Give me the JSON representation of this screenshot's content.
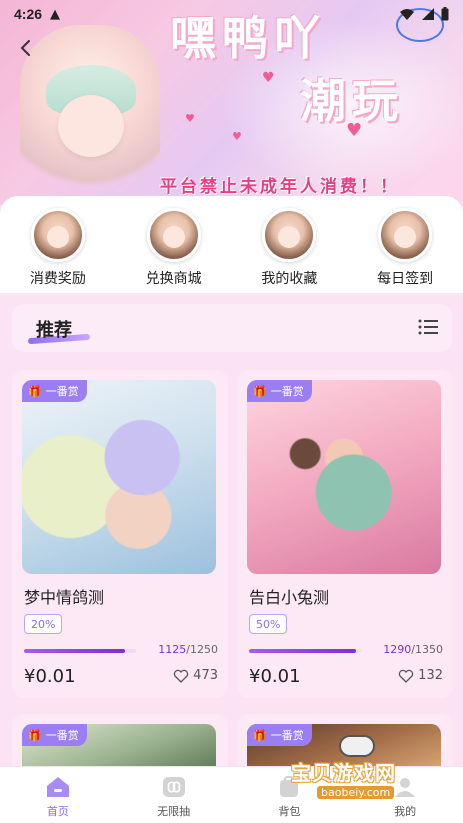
{
  "status_bar": {
    "time": "4:26"
  },
  "banner": {
    "title_line1": "嘿鸭吖",
    "title_line2": "潮玩",
    "notice": "平台禁止未成年人消费！！"
  },
  "shortcuts": [
    {
      "label": "消费奖励",
      "icon": "doll-avatar-icon"
    },
    {
      "label": "兑换商城",
      "icon": "doll-avatar-icon"
    },
    {
      "label": "我的收藏",
      "icon": "doll-avatar-icon"
    },
    {
      "label": "每日签到",
      "icon": "doll-avatar-icon"
    }
  ],
  "section": {
    "title": "推荐",
    "menu_icon": "list-menu-icon"
  },
  "products": [
    {
      "tag": "一番赏",
      "name": "梦中情鸽测",
      "percent": "20%",
      "progress": 0.9,
      "sold": "1125",
      "total": "/1250",
      "price": "¥0.01",
      "likes": "473"
    },
    {
      "tag": "一番赏",
      "name": "告白小兔测",
      "percent": "50%",
      "progress": 0.956,
      "sold": "1290",
      "total": "/1350",
      "price": "¥0.01",
      "likes": "132"
    },
    {
      "tag": "一番赏"
    },
    {
      "tag": "一番赏"
    }
  ],
  "bottom_nav": [
    {
      "label": "首页",
      "icon": "home-icon",
      "active": true
    },
    {
      "label": "无限抽",
      "icon": "infinity-icon",
      "active": false
    },
    {
      "label": "背包",
      "icon": "backpack-icon",
      "active": false
    },
    {
      "label": "我的",
      "icon": "profile-icon",
      "active": false
    }
  ],
  "watermark": {
    "text": "宝贝游戏网",
    "url": "baobeiy.com"
  },
  "colors": {
    "accent": "#8c6fe9",
    "progress": "#7c2fd3",
    "notice": "#e53d86",
    "page_bg": "#fbe3f3"
  }
}
